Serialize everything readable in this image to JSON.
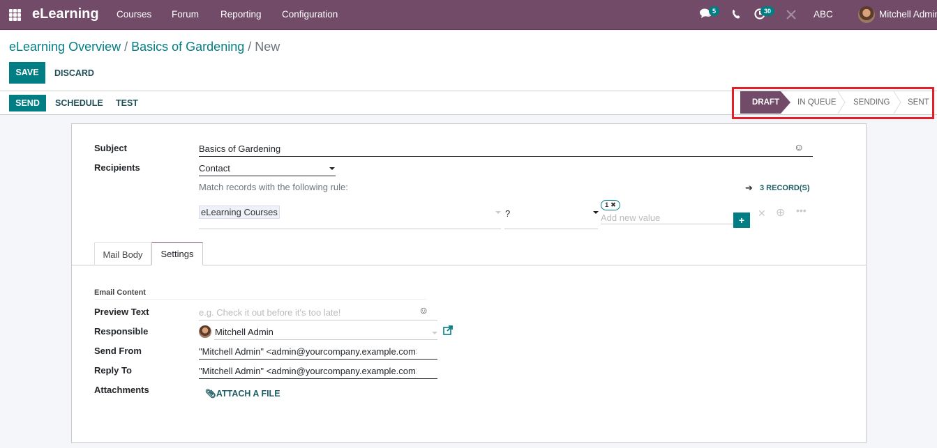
{
  "navbar": {
    "app_name": "eLearning",
    "menus": [
      "Courses",
      "Forum",
      "Reporting",
      "Configuration"
    ],
    "messages_badge": "5",
    "activities_badge": "30",
    "company": "ABC",
    "user": "Mitchell Admin",
    "icons": [
      "apps-grid-icon",
      "chat-icon",
      "phone-icon",
      "clock-icon",
      "tools-icon"
    ]
  },
  "breadcrumb": {
    "items": [
      "eLearning Overview",
      "Basics of Gardening"
    ],
    "separator": "/",
    "current": "New"
  },
  "actions": {
    "save": "SAVE",
    "discard": "DISCARD",
    "send": "SEND",
    "schedule": "SCHEDULE",
    "test": "TEST"
  },
  "statusbar": {
    "stages": [
      "DRAFT",
      "IN QUEUE",
      "SENDING",
      "SENT"
    ],
    "active": "DRAFT",
    "highlight_color": "#e41d2a"
  },
  "form": {
    "subject_label": "Subject",
    "subject_value": "Basics of Gardening",
    "recipients_label": "Recipients",
    "recipients_value": "Contact",
    "rule_text": "Match records with the following rule:",
    "records_link": "3 RECORD(S)",
    "domain": {
      "field": "eLearning Courses",
      "operator": "?",
      "tag": "1",
      "value_placeholder": "Add new value"
    }
  },
  "tabs": {
    "items": [
      "Mail Body",
      "Settings"
    ],
    "active": "Settings"
  },
  "settings": {
    "section_title": "Email Content",
    "preview_label": "Preview Text",
    "preview_placeholder": "e.g. Check it out before it's too late!",
    "responsible_label": "Responsible",
    "responsible_value": "Mitchell Admin",
    "send_from_label": "Send From",
    "send_from_value": "\"Mitchell Admin\" <admin@yourcompany.example.com>",
    "reply_to_label": "Reply To",
    "reply_to_value": "\"Mitchell Admin\" <admin@yourcompany.example.com>",
    "attachments_label": "Attachments",
    "attach_button": "ATTACH A FILE"
  },
  "colors": {
    "brand": "#714b67",
    "primary": "#017e84"
  }
}
